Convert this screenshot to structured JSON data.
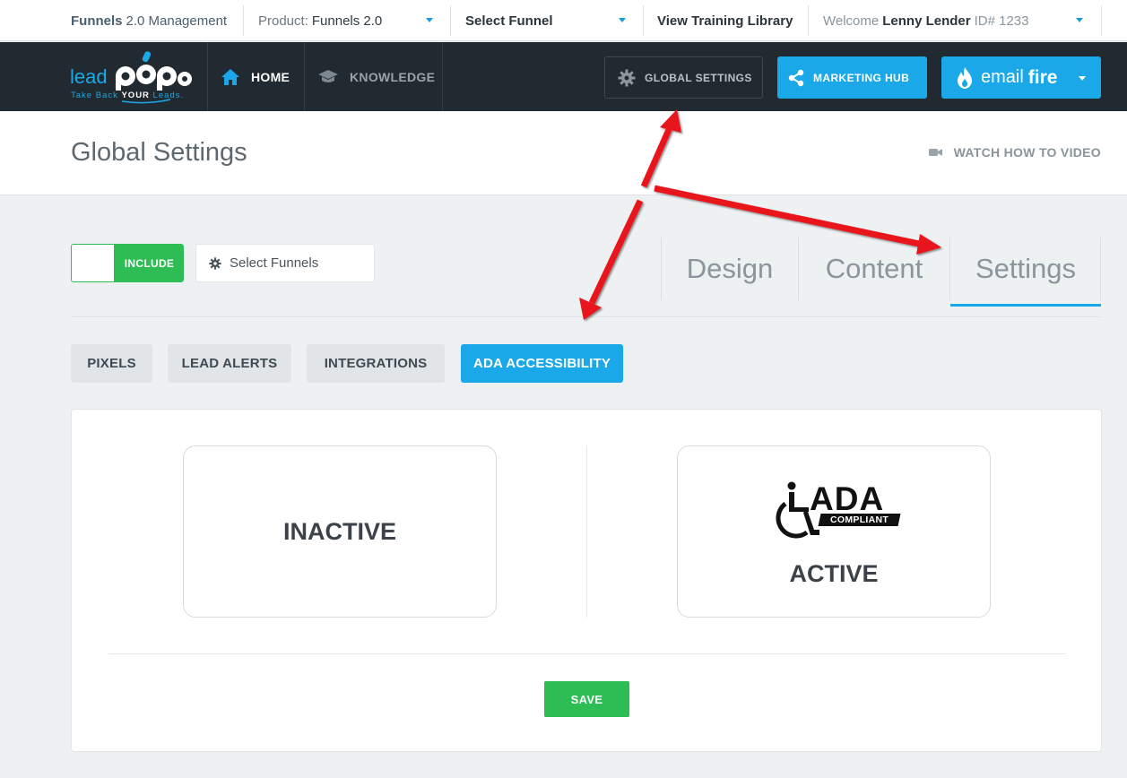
{
  "topbar": {
    "management_prefix": "Funnels",
    "management_suffix": "2.0 Management",
    "product_prefix": "Product:",
    "product_value": "Funnels 2.0",
    "select_funnel": "Select Funnel",
    "training": "View Training Library",
    "welcome_prefix": "Welcome",
    "user_name": "Lenny Lender",
    "user_id": "ID# 1233"
  },
  "logo": {
    "text": "leadPops",
    "tagline": "Take Back YOUR Leads."
  },
  "nav": {
    "home": "HOME",
    "knowledge": "KNOWLEDGE",
    "global_settings": "GLOBAL SETTINGS",
    "marketing_hub": "MARKETING HUB",
    "email_fire_a": "email",
    "email_fire_b": "fire"
  },
  "header": {
    "title": "Global Settings",
    "video_link": "WATCH HOW TO VIDEO"
  },
  "filter": {
    "include": "INCLUDE",
    "select_funnels": "Select Funnels"
  },
  "tabs": [
    {
      "label": "Design"
    },
    {
      "label": "Content"
    },
    {
      "label": "Settings"
    }
  ],
  "active_tab": "Settings",
  "subtabs": [
    {
      "label": "PIXELS"
    },
    {
      "label": "LEAD ALERTS"
    },
    {
      "label": "INTEGRATIONS"
    },
    {
      "label": "ADA ACCESSIBILITY"
    }
  ],
  "active_subtab": "ADA ACCESSIBILITY",
  "ada": {
    "inactive_label": "INACTIVE",
    "active_label": "ACTIVE",
    "badge_title": "ADA",
    "badge_sub": "COMPLIANT"
  },
  "save_label": "SAVE",
  "colors": {
    "brand_blue": "#1aa8e8",
    "success_green": "#2dbd54",
    "nav_dark": "#222a31",
    "annotation_red": "#e8141c"
  }
}
